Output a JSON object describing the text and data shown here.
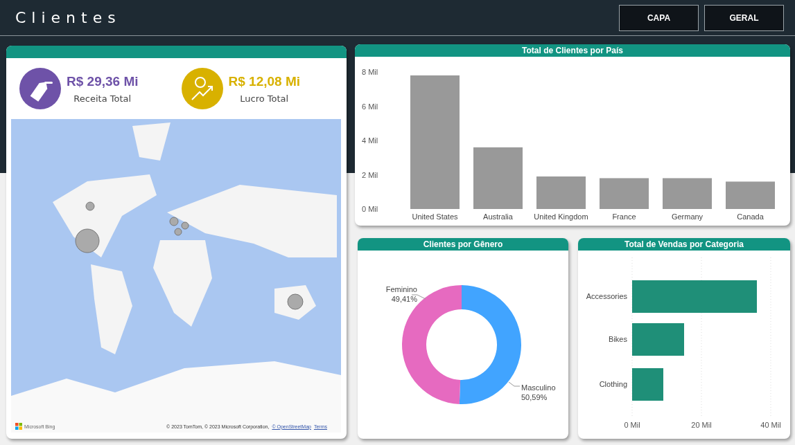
{
  "header": {
    "title": "Clientes",
    "buttons": [
      {
        "label": "CAPA"
      },
      {
        "label": "GERAL"
      }
    ]
  },
  "summary": {
    "kpis": [
      {
        "kind": "revenue",
        "value": "R$ 29,36 Mi",
        "label": "Receita Total",
        "color": "#6e52a8"
      },
      {
        "kind": "profit",
        "value": "R$ 12,08 Mi",
        "label": "Lucro Total",
        "color": "#d8b100"
      }
    ],
    "map": {
      "kind": "picture",
      "logo_text": "Microsoft Bing",
      "credits": "© 2023 TomTom, © 2023 Microsoft Corporation,",
      "links": [
        "© OpenStreetMap",
        "Terms"
      ]
    }
  },
  "country_chart": {
    "title": "Total de Clientes por País",
    "chart_data": {
      "type": "bar",
      "categories": [
        "United States",
        "Australia",
        "United Kingdom",
        "France",
        "Germany",
        "Canada"
      ],
      "series": [
        {
          "color": "#999999",
          "values": [
            7.8,
            3.6,
            1.9,
            1.8,
            1.8,
            1.6
          ]
        }
      ],
      "ylim": [
        0,
        8
      ],
      "yticks": [
        {
          "value": 0,
          "label": "0 Mil"
        },
        {
          "value": 2,
          "label": "2 Mil"
        },
        {
          "value": 4,
          "label": "4 Mil"
        },
        {
          "value": 6,
          "label": "6 Mil"
        },
        {
          "value": 8,
          "label": "8 Mil"
        }
      ]
    }
  },
  "gender_chart": {
    "title": "Clientes por Gênero",
    "chart_data": {
      "type": "donut",
      "categories": [
        "Masculino",
        "Feminino"
      ],
      "series": [
        {
          "values": [
            50.59,
            49.41
          ]
        }
      ],
      "colors": [
        "#41a4ff",
        "#e66ac0"
      ],
      "value_labels": [
        "50,59%",
        "49,41%"
      ]
    }
  },
  "category_chart": {
    "title": "Total de Vendas por Categoria",
    "chart_data": {
      "type": "bar",
      "orientation": "horizontal",
      "categories": [
        "Accessories",
        "Bikes",
        "Clothing"
      ],
      "series": [
        {
          "color": "#1f8f78",
          "values": [
            36,
            15,
            9
          ]
        }
      ],
      "xlim": [
        0,
        40
      ],
      "xticks": [
        {
          "value": 0,
          "label": "0 Mil"
        },
        {
          "value": 20,
          "label": "20 Mil"
        },
        {
          "value": 40,
          "label": "40 Mil"
        }
      ]
    }
  }
}
